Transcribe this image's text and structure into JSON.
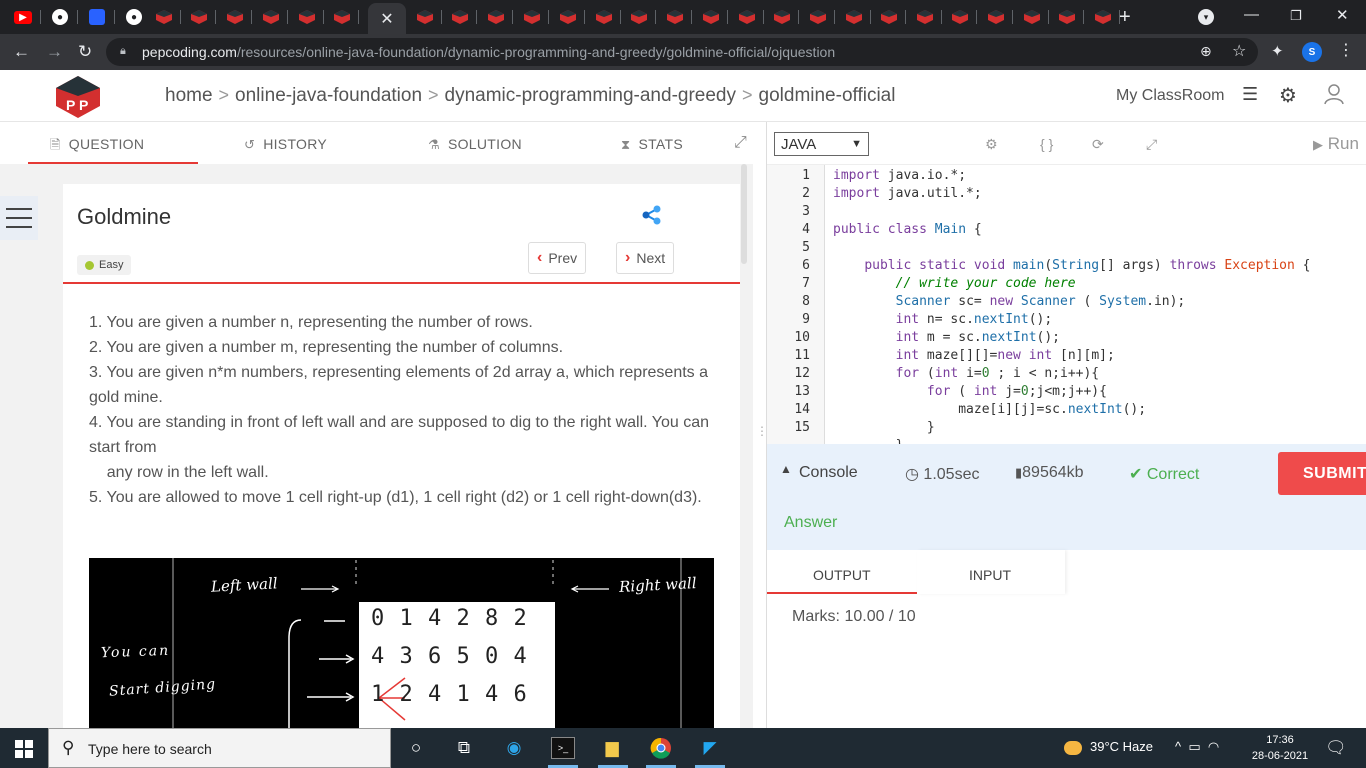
{
  "browser": {
    "url_domain": "pepcoding.com",
    "url_path": "/resources/online-java-foundation/dynamic-programming-and-greedy/goldmine-official/ojquestion",
    "profile_initial": "S",
    "new_tab": "+",
    "active_tab_close": "✕"
  },
  "header": {
    "breadcrumbs": [
      "home",
      "online-java-foundation",
      "dynamic-programming-and-greedy",
      "goldmine-official"
    ],
    "crumb_sep": ">",
    "my_classroom": "My ClassRoom"
  },
  "question_tabs": [
    {
      "label": "QUESTION"
    },
    {
      "label": "HISTORY"
    },
    {
      "label": "SOLUTION"
    },
    {
      "label": "STATS"
    }
  ],
  "question": {
    "title": "Goldmine",
    "difficulty": "Easy",
    "prev_label": "Prev",
    "next_label": "Next",
    "lines": [
      "1. You are given a number n, representing the number of rows.",
      "2. You are given a number m, representing the number of columns.",
      "3. You are given n*m numbers, representing elements of 2d array a, which represents a gold mine.",
      "4. You are standing in front of left wall and are supposed to dig to the right wall. You can start from",
      "    any row in the left wall.",
      "5. You are allowed to move 1 cell right-up (d1), 1 cell right (d2) or 1 cell right-down(d3)."
    ]
  },
  "figure": {
    "left_wall": "Left wall",
    "right_wall": "Right wall",
    "you_can": "You can",
    "start_digging": "Start digging",
    "grid_rows": [
      "0 1 4 2 8 2",
      "4 3 6 5 0 4",
      "1 2 4 1 4 6"
    ]
  },
  "editor": {
    "language": "JAVA",
    "run_label": "Run",
    "line_numbers": [
      "1",
      "2",
      "3",
      "4",
      "5",
      "6",
      "7",
      "8",
      "9",
      "10",
      "11",
      "12",
      "13",
      "14",
      "15"
    ]
  },
  "console": {
    "label": "Console",
    "time": "1.05sec",
    "memory": "89564kb",
    "status": "Correct",
    "submit_label": "SUBMIT",
    "answer_label": "Answer",
    "output_tab": "OUTPUT",
    "input_tab": "INPUT",
    "marks": "Marks: 10.00 / 10"
  },
  "taskbar": {
    "search_placeholder": "Type here to search",
    "weather": "39°C  Haze",
    "time": "17:36",
    "date": "28-06-2021"
  },
  "colors": {
    "accent_red": "#e53935",
    "success_green": "#4caf50",
    "console_bg": "#e8f1fb",
    "browser_dark": "#202124"
  }
}
